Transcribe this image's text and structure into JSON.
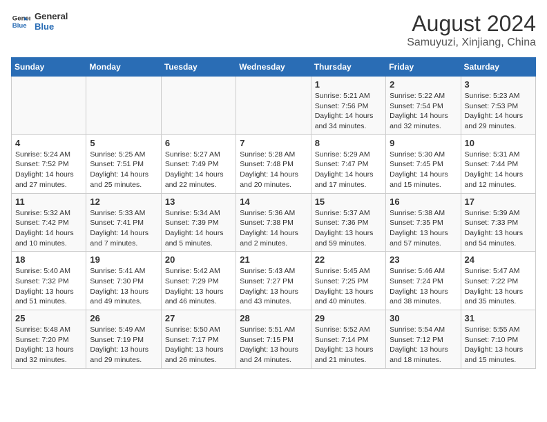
{
  "header": {
    "logo_line1": "General",
    "logo_line2": "Blue",
    "title": "August 2024",
    "subtitle": "Samuyuzi, Xinjiang, China"
  },
  "days_of_week": [
    "Sunday",
    "Monday",
    "Tuesday",
    "Wednesday",
    "Thursday",
    "Friday",
    "Saturday"
  ],
  "weeks": [
    [
      {
        "day": "",
        "detail": ""
      },
      {
        "day": "",
        "detail": ""
      },
      {
        "day": "",
        "detail": ""
      },
      {
        "day": "",
        "detail": ""
      },
      {
        "day": "1",
        "detail": "Sunrise: 5:21 AM\nSunset: 7:56 PM\nDaylight: 14 hours\nand 34 minutes."
      },
      {
        "day": "2",
        "detail": "Sunrise: 5:22 AM\nSunset: 7:54 PM\nDaylight: 14 hours\nand 32 minutes."
      },
      {
        "day": "3",
        "detail": "Sunrise: 5:23 AM\nSunset: 7:53 PM\nDaylight: 14 hours\nand 29 minutes."
      }
    ],
    [
      {
        "day": "4",
        "detail": "Sunrise: 5:24 AM\nSunset: 7:52 PM\nDaylight: 14 hours\nand 27 minutes."
      },
      {
        "day": "5",
        "detail": "Sunrise: 5:25 AM\nSunset: 7:51 PM\nDaylight: 14 hours\nand 25 minutes."
      },
      {
        "day": "6",
        "detail": "Sunrise: 5:27 AM\nSunset: 7:49 PM\nDaylight: 14 hours\nand 22 minutes."
      },
      {
        "day": "7",
        "detail": "Sunrise: 5:28 AM\nSunset: 7:48 PM\nDaylight: 14 hours\nand 20 minutes."
      },
      {
        "day": "8",
        "detail": "Sunrise: 5:29 AM\nSunset: 7:47 PM\nDaylight: 14 hours\nand 17 minutes."
      },
      {
        "day": "9",
        "detail": "Sunrise: 5:30 AM\nSunset: 7:45 PM\nDaylight: 14 hours\nand 15 minutes."
      },
      {
        "day": "10",
        "detail": "Sunrise: 5:31 AM\nSunset: 7:44 PM\nDaylight: 14 hours\nand 12 minutes."
      }
    ],
    [
      {
        "day": "11",
        "detail": "Sunrise: 5:32 AM\nSunset: 7:42 PM\nDaylight: 14 hours\nand 10 minutes."
      },
      {
        "day": "12",
        "detail": "Sunrise: 5:33 AM\nSunset: 7:41 PM\nDaylight: 14 hours\nand 7 minutes."
      },
      {
        "day": "13",
        "detail": "Sunrise: 5:34 AM\nSunset: 7:39 PM\nDaylight: 14 hours\nand 5 minutes."
      },
      {
        "day": "14",
        "detail": "Sunrise: 5:36 AM\nSunset: 7:38 PM\nDaylight: 14 hours\nand 2 minutes."
      },
      {
        "day": "15",
        "detail": "Sunrise: 5:37 AM\nSunset: 7:36 PM\nDaylight: 13 hours\nand 59 minutes."
      },
      {
        "day": "16",
        "detail": "Sunrise: 5:38 AM\nSunset: 7:35 PM\nDaylight: 13 hours\nand 57 minutes."
      },
      {
        "day": "17",
        "detail": "Sunrise: 5:39 AM\nSunset: 7:33 PM\nDaylight: 13 hours\nand 54 minutes."
      }
    ],
    [
      {
        "day": "18",
        "detail": "Sunrise: 5:40 AM\nSunset: 7:32 PM\nDaylight: 13 hours\nand 51 minutes."
      },
      {
        "day": "19",
        "detail": "Sunrise: 5:41 AM\nSunset: 7:30 PM\nDaylight: 13 hours\nand 49 minutes."
      },
      {
        "day": "20",
        "detail": "Sunrise: 5:42 AM\nSunset: 7:29 PM\nDaylight: 13 hours\nand 46 minutes."
      },
      {
        "day": "21",
        "detail": "Sunrise: 5:43 AM\nSunset: 7:27 PM\nDaylight: 13 hours\nand 43 minutes."
      },
      {
        "day": "22",
        "detail": "Sunrise: 5:45 AM\nSunset: 7:25 PM\nDaylight: 13 hours\nand 40 minutes."
      },
      {
        "day": "23",
        "detail": "Sunrise: 5:46 AM\nSunset: 7:24 PM\nDaylight: 13 hours\nand 38 minutes."
      },
      {
        "day": "24",
        "detail": "Sunrise: 5:47 AM\nSunset: 7:22 PM\nDaylight: 13 hours\nand 35 minutes."
      }
    ],
    [
      {
        "day": "25",
        "detail": "Sunrise: 5:48 AM\nSunset: 7:20 PM\nDaylight: 13 hours\nand 32 minutes."
      },
      {
        "day": "26",
        "detail": "Sunrise: 5:49 AM\nSunset: 7:19 PM\nDaylight: 13 hours\nand 29 minutes."
      },
      {
        "day": "27",
        "detail": "Sunrise: 5:50 AM\nSunset: 7:17 PM\nDaylight: 13 hours\nand 26 minutes."
      },
      {
        "day": "28",
        "detail": "Sunrise: 5:51 AM\nSunset: 7:15 PM\nDaylight: 13 hours\nand 24 minutes."
      },
      {
        "day": "29",
        "detail": "Sunrise: 5:52 AM\nSunset: 7:14 PM\nDaylight: 13 hours\nand 21 minutes."
      },
      {
        "day": "30",
        "detail": "Sunrise: 5:54 AM\nSunset: 7:12 PM\nDaylight: 13 hours\nand 18 minutes."
      },
      {
        "day": "31",
        "detail": "Sunrise: 5:55 AM\nSunset: 7:10 PM\nDaylight: 13 hours\nand 15 minutes."
      }
    ]
  ]
}
